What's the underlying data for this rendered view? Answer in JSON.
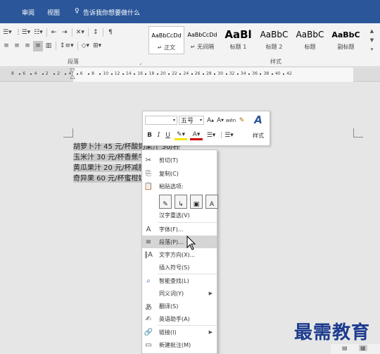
{
  "topbar": {
    "tabs": [
      "审阅",
      "视图"
    ],
    "tell_me": "告诉我你想要做什么"
  },
  "ribbon": {
    "styles": [
      {
        "preview": "AaBbCcDd",
        "name": "↵ 正文"
      },
      {
        "preview": "AaBbCcDd",
        "name": "↵ 无间隔"
      },
      {
        "preview": "AaBl",
        "name": "标题 1"
      },
      {
        "preview": "AaBbC",
        "name": "标题 2"
      },
      {
        "preview": "AaBbC",
        "name": "标题"
      },
      {
        "preview": "AaBbC",
        "name": "副标题"
      }
    ],
    "group_paragraph": "段落",
    "group_styles": "样式"
  },
  "ruler": {
    "ticks": [
      "8",
      "6",
      "4",
      "2",
      "2",
      "4",
      "6",
      "8",
      "10",
      "12",
      "14",
      "16",
      "18",
      "20",
      "22",
      "24",
      "26",
      "28",
      "30",
      "32",
      "34",
      "36",
      "38",
      "40",
      "42"
    ]
  },
  "document": {
    "lines": [
      "胡萝卜汁 45 元/杯酸奶果汁 30/杯",
      "玉米汁 30 元/杯香蕉牛",
      "黄瓜果汁 20 元/杯减肥",
      "奇异果 60 元/杯蜜柑奶"
    ]
  },
  "mini_toolbar": {
    "font": "",
    "size": "五号",
    "bold": "B",
    "italic": "I",
    "underline": "U",
    "styles": "样式"
  },
  "context_menu": {
    "items": [
      {
        "label": "剪切(T)",
        "icon": "✂"
      },
      {
        "label": "复制(C)",
        "icon": "⎘"
      },
      {
        "label": "粘贴选项:",
        "icon": "📋"
      },
      {
        "label": "汉字重选(V)",
        "icon": ""
      },
      {
        "label": "字体(F)...",
        "icon": "A"
      },
      {
        "label": "段落(P)...",
        "icon": "≡"
      },
      {
        "label": "文字方向(X)...",
        "icon": "‖A"
      },
      {
        "label": "插入符号(S)",
        "icon": ""
      },
      {
        "label": "智能查找(L)",
        "icon": "⌕"
      },
      {
        "label": "同义词(Y)",
        "icon": ""
      },
      {
        "label": "翻译(S)",
        "icon": "あ"
      },
      {
        "label": "英语助手(A)",
        "icon": "✍"
      },
      {
        "label": "链接(I)",
        "icon": "🔗"
      },
      {
        "label": "新建批注(M)",
        "icon": "▭"
      }
    ]
  },
  "watermark": "最需教育"
}
